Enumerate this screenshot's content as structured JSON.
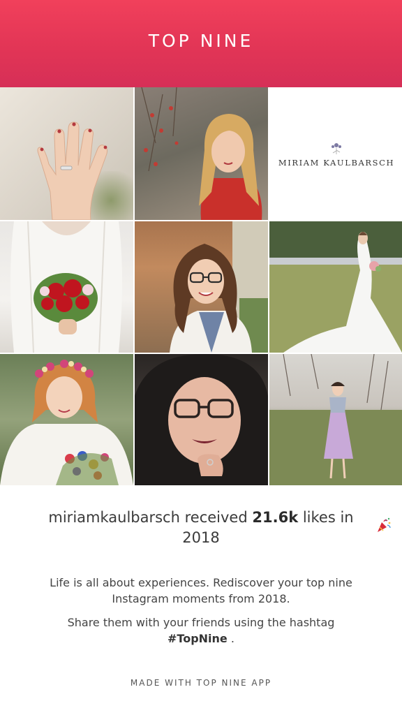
{
  "header": {
    "title": "TOP NINE",
    "background_color": "#e23556"
  },
  "grid": {
    "tiles": [
      {
        "icon": "photo-hand-ring"
      },
      {
        "icon": "photo-woman-red-dress"
      },
      {
        "icon": "logo",
        "logo_text": "MIRIAM KAULBARSCH"
      },
      {
        "icon": "photo-bridal-bouquet"
      },
      {
        "icon": "photo-woman-glasses"
      },
      {
        "icon": "photo-bride-park"
      },
      {
        "icon": "photo-flower-crown-bride"
      },
      {
        "icon": "photo-selfie"
      },
      {
        "icon": "photo-dirndl-woman"
      }
    ]
  },
  "summary": {
    "username": "miriamkaulbarsch",
    "received_text": "received",
    "likes_count": "21.6k",
    "likes_in_text": "likes in",
    "year": "2018",
    "emoji_icon": "party-popper-icon"
  },
  "message": {
    "line1": "Life is all about experiences. Rediscover your top nine Instagram moments from 2018.",
    "line2_prefix": "Share them with your friends using the hashtag",
    "hashtag": "#TopNine",
    "line2_suffix": "."
  },
  "footer": {
    "text": "MADE WITH TOP NINE APP"
  }
}
